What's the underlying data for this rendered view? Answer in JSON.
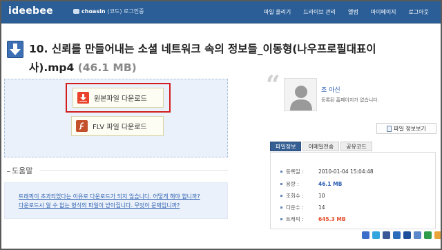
{
  "header": {
    "logo": "ideebee",
    "user_name": "choasin",
    "user_suffix": "(코드) 로그인중",
    "nav": [
      "파일 올리기",
      "드라이브 관리",
      "앨범",
      "마이페이지",
      "로그아웃"
    ]
  },
  "title": {
    "main": "10. 신뢰를 만들어내는 소셜 네트워크 속의 정보들_이동형(나우프로필대표이사).mp4",
    "size": "(46.1 MB)"
  },
  "download": {
    "original_label": "원본파일 다운로드",
    "flv_label": "FLV 파일 다운로드"
  },
  "help": {
    "title": "도움말",
    "links": [
      "트래픽이 초과되었다는 이유로 다운로드가 되지 않습니다. 어떻게 해야 합니까?",
      "다운로드시 알 수 없는 형식의 파일이 받아집니다. 무엇이 문제입니까?"
    ]
  },
  "uploader": {
    "name": "조 아신",
    "message": "등록된 홈페이지가 없습니다."
  },
  "file_info_button": "파일 정보보기",
  "tabs": [
    "파일정보",
    "이메일전송",
    "공유코드"
  ],
  "stats": [
    {
      "label": "등록일 :",
      "value": "2010-01-04 15:04:48",
      "style": ""
    },
    {
      "label": "용량 :",
      "value": "46.1 MB",
      "style": "blue"
    },
    {
      "label": "조회수 :",
      "value": "10",
      "style": ""
    },
    {
      "label": "다운수 :",
      "value": "14",
      "style": ""
    },
    {
      "label": "트래픽 :",
      "value": "645.3 MB",
      "style": "red"
    }
  ],
  "share_icons": [
    {
      "name": "delicious-icon",
      "color": "#3b6fc9"
    },
    {
      "name": "twitter-icon",
      "color": "#33a6df"
    },
    {
      "name": "facebook-icon",
      "color": "#3b5998"
    },
    {
      "name": "linkedin-icon",
      "color": "#2a6ebb"
    },
    {
      "name": "myspace-icon",
      "color": "#1d4f9a"
    },
    {
      "name": "daum-icon",
      "color": "#5a88c9"
    },
    {
      "name": "blog-icon",
      "color": "#2f9c4a"
    },
    {
      "name": "me2day-icon",
      "color": "#e8a43a"
    }
  ],
  "colors": {
    "header_bg": "#2b5e97",
    "highlight": "#d11d1d",
    "link": "#2a5db0",
    "traffic": "#e24d2c"
  }
}
